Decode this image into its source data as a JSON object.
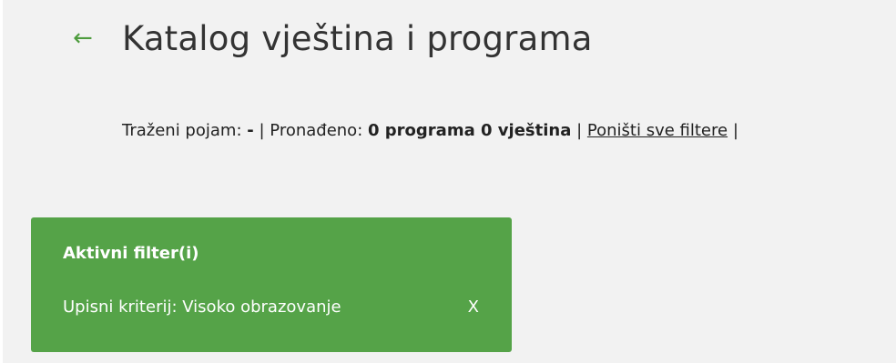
{
  "header": {
    "back_icon": "←",
    "title": "Katalog vještina i programa"
  },
  "summary": {
    "query_label": "Traženi pojam:",
    "query_value": "-",
    "separator": "|",
    "found_label": "Pronađeno:",
    "found_value": "0 programa 0 vještina",
    "reset_link": "Poništi sve filtere"
  },
  "filters": {
    "title": "Aktivni filter(i)",
    "items": [
      {
        "label": "Upisni kriterij: Visoko obrazovanje",
        "remove": "X"
      }
    ]
  },
  "colors": {
    "accent_green": "#55a348",
    "arrow_green": "#4e9c3e",
    "background": "#f2f2f2"
  }
}
